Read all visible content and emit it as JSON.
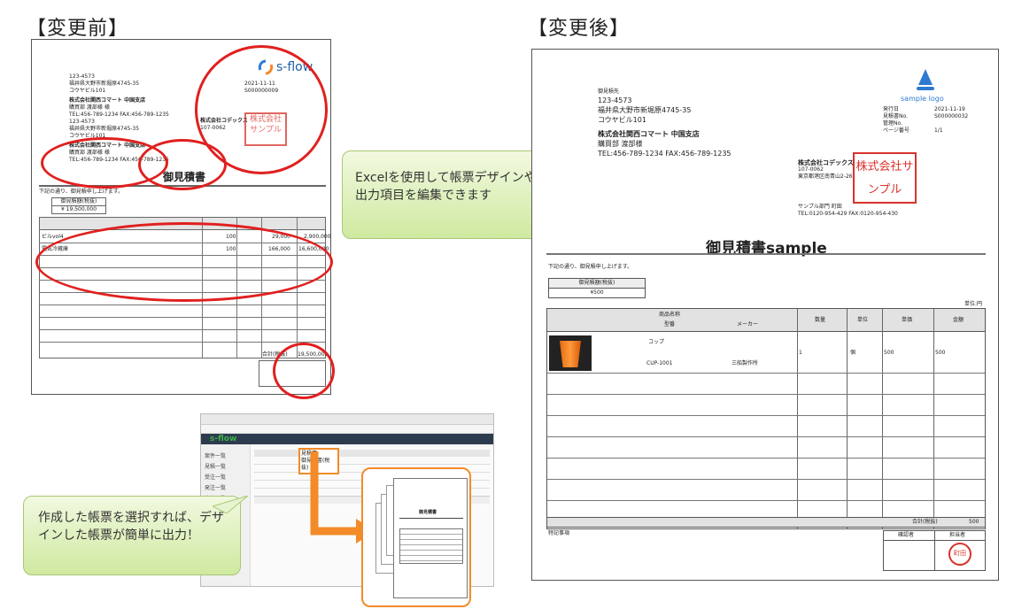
{
  "labels": {
    "before": "【変更前】",
    "after": "【変更後】"
  },
  "callouts": {
    "excel": "Excelを使用して帳票デザインや出力項目を編集できます",
    "select": "作成した帳票を選択すれば、デザインした帳票が簡単に出力！"
  },
  "after_doc": {
    "to_label": "御見積先",
    "zip": "123-4573",
    "addr1": "福井県大野市新堀原4745-35",
    "addr2": "コウヤビル101",
    "company": "株式会社関西コマート 中国支店",
    "dept": "購買部 渡部様",
    "tel": "TEL:456-789-1234 FAX:456-789-1235",
    "logo": "sample logo",
    "meta": [
      {
        "k": "発行日",
        "v": "2021-11-19"
      },
      {
        "k": "見積書No.",
        "v": "S000000032"
      },
      {
        "k": "管理No.",
        "v": ""
      },
      {
        "k": "ページ番号",
        "v": "1/1"
      }
    ],
    "issuer": "株式会社コデックス",
    "issuer_zip": "107-0062",
    "issuer_addr": "東京都港区南青山2-26",
    "issuer_dept": "サンプル部門 町田",
    "issuer_tel": "TEL:0120-954-429 FAX:0120-954-430",
    "seal_text": "株式会社サンプル",
    "title": "御見積書sample",
    "intro": "下記の通り、御見積申し上げます。",
    "total_label": "御見積額(税抜)",
    "total_value": "¥500",
    "unit_note": "単位:円",
    "cols": [
      "商品名称",
      "型番",
      "メーカー",
      "数量",
      "単位",
      "単価",
      "金額"
    ],
    "item": {
      "name": "コップ",
      "model": "CUP-1001",
      "maker": "三船製作所",
      "qty": "1",
      "unit": "個",
      "price": "500",
      "amount": "500"
    },
    "sum_label": "合計(税抜)",
    "sum_value": "500",
    "remarks": "特記事項",
    "confirm": "確認者",
    "charge": "担当者",
    "stamp": "町田"
  },
  "before_doc": {
    "logo": "s-flow",
    "zip": "123-4573",
    "addr1": "福井県大野市新堀原4745-35",
    "addr2": "コウヤビル101",
    "company": "株式会社関西コマート 中国支店",
    "dept": "購買部 渡部様 様",
    "tel": "TEL:456-789-1234 FAX:456-789-1235",
    "title": "御見積書",
    "intro": "下記の通り、御見積申し上げます。",
    "total_label": "御見積額(税抜)",
    "total_value": "¥ 19,500,000",
    "issuer": "株式会社コデックス",
    "issuer_zip": "107-0062",
    "meta_date": "2021-11-11",
    "meta_no": "S000000009",
    "seal_text": "株式会社サンプル",
    "sum_label": "合計(税抜)",
    "sum_value": "19,500,000",
    "rows": [
      {
        "name": "ビルvol4",
        "qty": "100",
        "unit": "個",
        "price": "29,000",
        "amount": "2,900,000"
      },
      {
        "name": "電気冷蔵庫",
        "qty": "100",
        "unit": "個",
        "price": "166,000",
        "amount": "16,600,000"
      }
    ]
  },
  "app": {
    "brand": "s-flow",
    "sidebar": [
      "案件一覧",
      "見積一覧",
      "受注一覧",
      "発注一覧",
      "売上一覧"
    ],
    "dropdown": [
      "見積書",
      "御見積書(税抜)"
    ],
    "mini_title": "御見積書"
  },
  "colors": {
    "red": "#e0201f",
    "orange": "#f28b28",
    "green_start": "#f2f9e0",
    "green_end": "#cfe9a0"
  }
}
